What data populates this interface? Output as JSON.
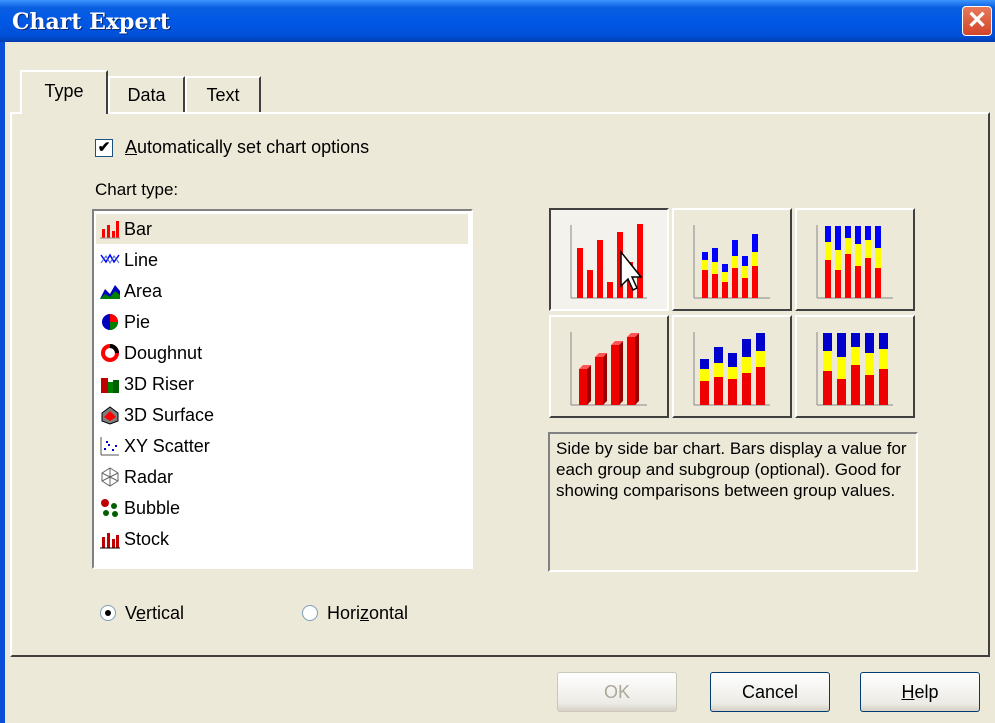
{
  "window": {
    "title": "Chart Expert",
    "close_glyph": "✕"
  },
  "tabs": [
    {
      "label": "Type"
    },
    {
      "label": "Data"
    },
    {
      "label": "Text"
    }
  ],
  "auto_options": {
    "checked": true,
    "check_glyph": "✔",
    "label_pre": "",
    "label_u": "A",
    "label_post": "utomatically set chart options"
  },
  "chart_type_label": "Chart type:",
  "chart_types": [
    {
      "label": "Bar",
      "icon": "bar-chart-icon",
      "selected": true
    },
    {
      "label": "Line",
      "icon": "line-chart-icon"
    },
    {
      "label": "Area",
      "icon": "area-chart-icon"
    },
    {
      "label": "Pie",
      "icon": "pie-chart-icon"
    },
    {
      "label": "Doughnut",
      "icon": "doughnut-chart-icon"
    },
    {
      "label": "3D Riser",
      "icon": "3d-riser-icon"
    },
    {
      "label": "3D Surface",
      "icon": "3d-surface-icon"
    },
    {
      "label": "XY Scatter",
      "icon": "xy-scatter-icon"
    },
    {
      "label": "Radar",
      "icon": "radar-chart-icon"
    },
    {
      "label": "Bubble",
      "icon": "bubble-chart-icon"
    },
    {
      "label": "Stock",
      "icon": "stock-chart-icon"
    }
  ],
  "orientation": {
    "vertical": {
      "pre": "V",
      "u": "e",
      "post": "rtical",
      "selected": true
    },
    "horizontal": {
      "pre": "Hori",
      "u": "z",
      "post": "ontal",
      "selected": false
    }
  },
  "subtypes": [
    {
      "name": "side-by-side-bar",
      "selected": true
    },
    {
      "name": "stacked-bar"
    },
    {
      "name": "percent-bar"
    },
    {
      "name": "3d-side-by-side-bar"
    },
    {
      "name": "3d-stacked-bar"
    },
    {
      "name": "3d-percent-bar"
    }
  ],
  "description": "Side by side bar chart. Bars display a value for each group and subgroup (optional). Good for showing comparisons between group values.",
  "buttons": {
    "ok": {
      "label": "OK",
      "enabled": false
    },
    "cancel": {
      "label": "Cancel"
    },
    "help": {
      "u": "H",
      "post": "elp"
    }
  },
  "colors": {
    "red": "#FF0000",
    "yellow": "#FFFF00",
    "blue": "#0000FF"
  }
}
